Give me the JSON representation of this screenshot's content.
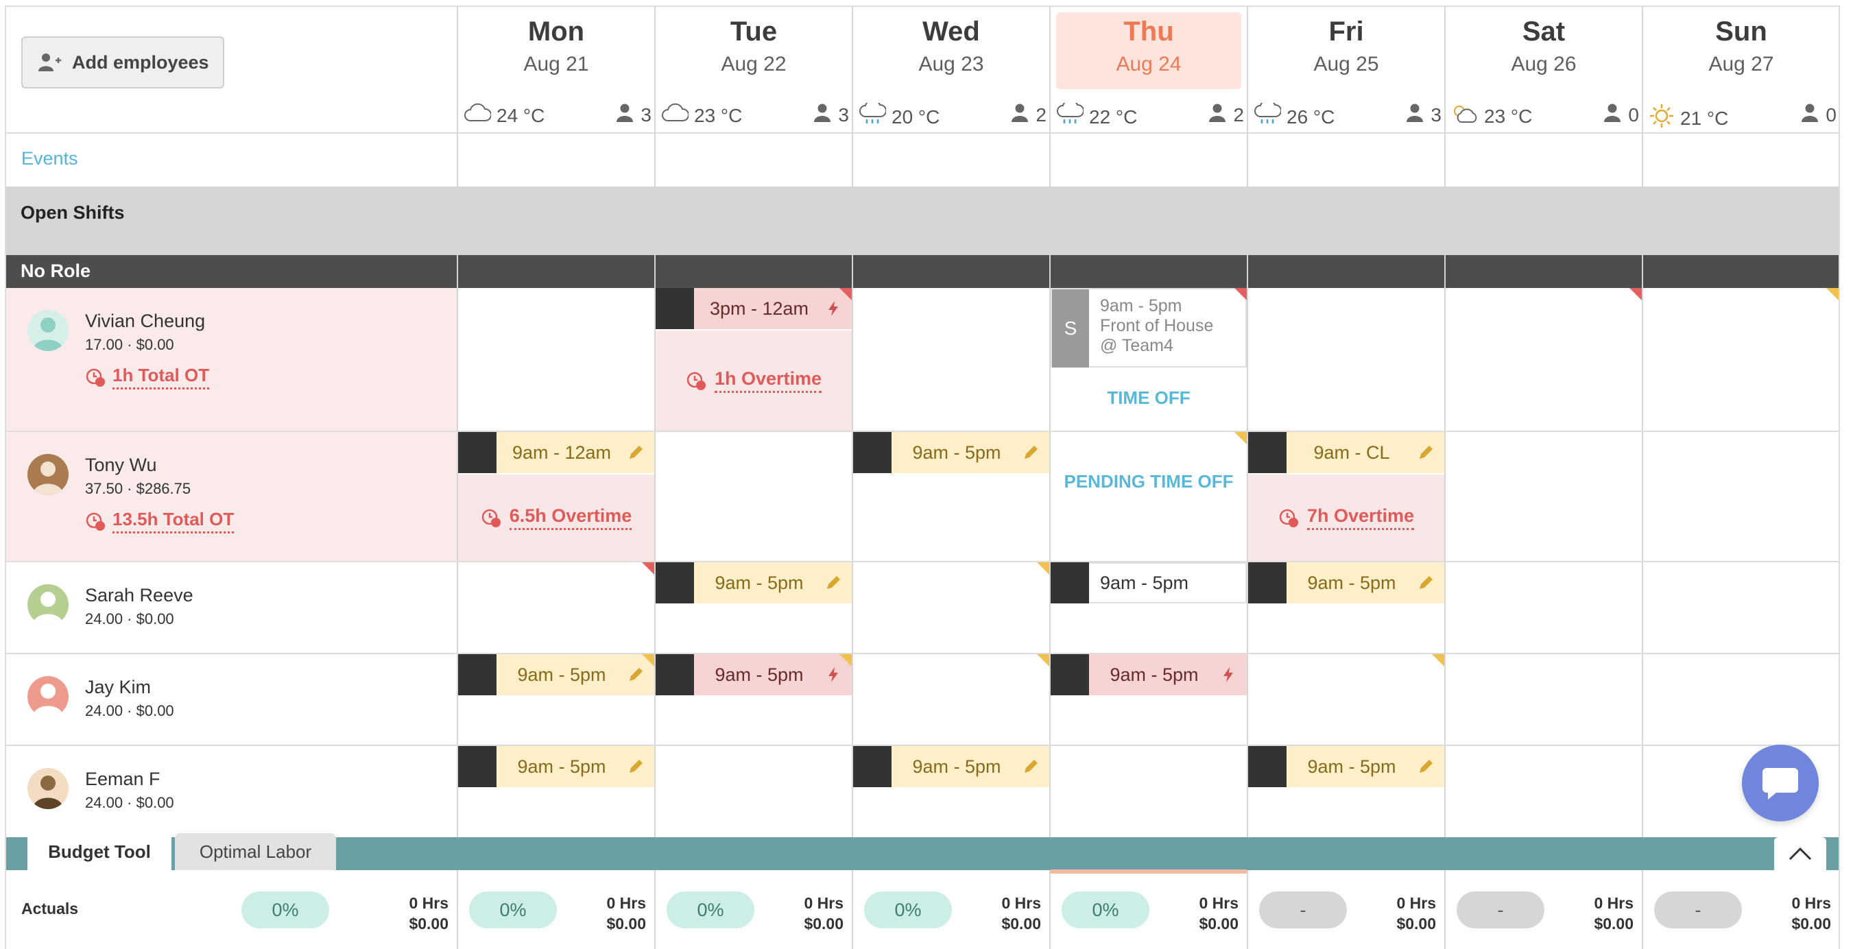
{
  "header": {
    "add_employees_label": "Add employees"
  },
  "days": [
    {
      "name": "Mon",
      "date": "Aug 21",
      "weather": "24 °C",
      "weather_icon": "cloud-icon",
      "staff": "3",
      "today": false
    },
    {
      "name": "Tue",
      "date": "Aug 22",
      "weather": "23 °C",
      "weather_icon": "cloud-icon",
      "staff": "3",
      "today": false
    },
    {
      "name": "Wed",
      "date": "Aug 23",
      "weather": "20 °C",
      "weather_icon": "rain-icon",
      "staff": "2",
      "today": false
    },
    {
      "name": "Thu",
      "date": "Aug 24",
      "weather": "22 °C",
      "weather_icon": "rain-icon",
      "staff": "2",
      "today": true
    },
    {
      "name": "Fri",
      "date": "Aug 25",
      "weather": "26 °C",
      "weather_icon": "rain-icon",
      "staff": "3",
      "today": false
    },
    {
      "name": "Sat",
      "date": "Aug 26",
      "weather": "23 °C",
      "weather_icon": "partly-sunny-icon",
      "staff": "0",
      "today": false
    },
    {
      "name": "Sun",
      "date": "Aug 27",
      "weather": "21 °C",
      "weather_icon": "sun-icon",
      "staff": "0",
      "today": false
    }
  ],
  "rows": {
    "events_label": "Events",
    "open_shifts_label": "Open Shifts",
    "role_label": "No Role"
  },
  "employees": [
    {
      "name": "Vivian Cheung",
      "rate": "17.00 · $0.00",
      "total_ot": "1h Total OT",
      "avatar_color": "#8fd0c4"
    },
    {
      "name": "Tony Wu",
      "rate": "37.50 · $286.75",
      "total_ot": "13.5h Total OT",
      "avatar_color": "#a97b4f"
    },
    {
      "name": "Sarah Reeve",
      "rate": "24.00 · $0.00",
      "total_ot": "",
      "avatar_color": "#b4cf8f"
    },
    {
      "name": "Jay Kim",
      "rate": "24.00 · $0.00",
      "total_ot": "",
      "avatar_color": "#ee9b8e"
    },
    {
      "name": "Eeman F",
      "rate": "24.00 · $0.00",
      "total_ot": "",
      "avatar_color": "#8a6a40"
    }
  ],
  "shifts": {
    "vivian_tue": "3pm - 12am",
    "vivian_tue_ot": "1h Overtime",
    "vivian_thu_label": "S",
    "vivian_thu_time": "9am - 5pm",
    "vivian_thu_position": "Front of House",
    "vivian_thu_location": "@ Team4",
    "vivian_thu_timeoff": "TIME OFF",
    "tony_mon": "9am - 12am",
    "tony_mon_ot": "6.5h Overtime",
    "tony_wed": "9am - 5pm",
    "tony_thu_pending": "PENDING TIME OFF",
    "tony_fri": "9am - CL",
    "tony_fri_ot": "7h Overtime",
    "sarah_tue": "9am - 5pm",
    "sarah_thu": "9am - 5pm",
    "sarah_fri": "9am - 5pm",
    "jay_mon": "9am - 5pm",
    "jay_tue": "9am - 5pm",
    "jay_thu": "9am - 5pm",
    "eeman_mon": "9am - 5pm",
    "eeman_wed": "9am - 5pm",
    "eeman_fri": "9am - 5pm"
  },
  "budget": {
    "tab_active": "Budget Tool",
    "tab_inactive": "Optimal Labor",
    "actuals_label": "Actuals",
    "summary": {
      "pct": "0%",
      "hrs": "0 Hrs",
      "cost": "$0.00"
    },
    "daily": [
      {
        "pct": "0%",
        "hrs": "0 Hrs",
        "cost": "$0.00",
        "state": "green"
      },
      {
        "pct": "0%",
        "hrs": "0 Hrs",
        "cost": "$0.00",
        "state": "green"
      },
      {
        "pct": "0%",
        "hrs": "0 Hrs",
        "cost": "$0.00",
        "state": "green"
      },
      {
        "pct": "0%",
        "hrs": "0 Hrs",
        "cost": "$0.00",
        "state": "green"
      },
      {
        "pct": "-",
        "hrs": "0 Hrs",
        "cost": "$0.00",
        "state": "grey"
      },
      {
        "pct": "-",
        "hrs": "0 Hrs",
        "cost": "$0.00",
        "state": "grey"
      },
      {
        "pct": "-",
        "hrs": "0 Hrs",
        "cost": "$0.00",
        "state": "grey"
      }
    ]
  }
}
